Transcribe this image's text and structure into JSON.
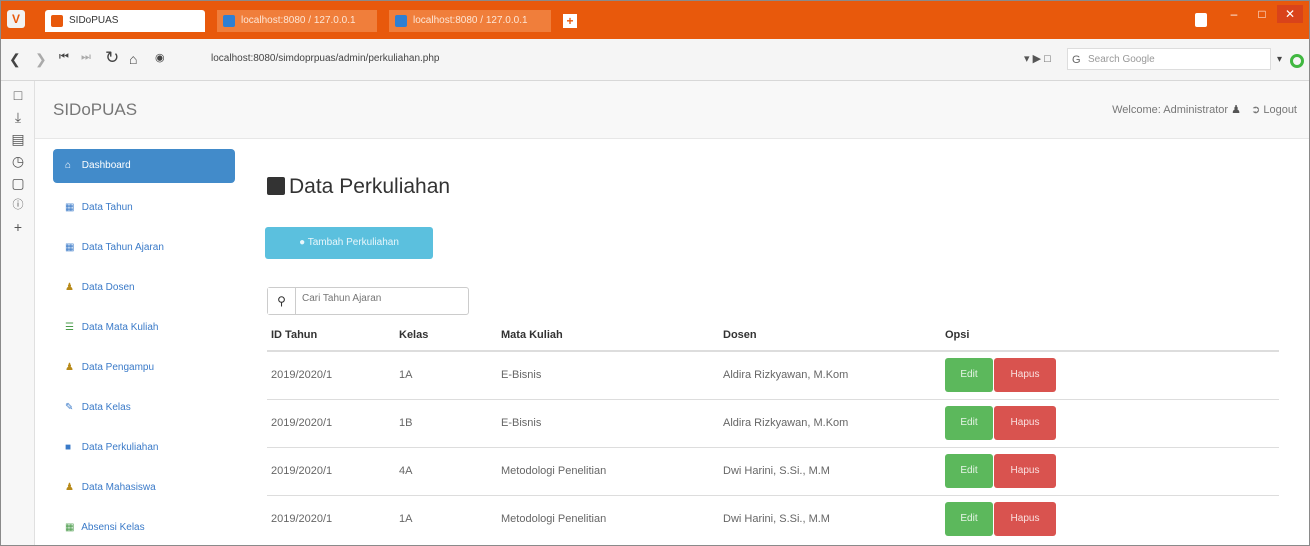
{
  "browser": {
    "tabs": [
      {
        "label": "SIDoPUAS"
      },
      {
        "label": "localhost:8080 / 127.0.0.1"
      },
      {
        "label": "localhost:8080 / 127.0.0.1"
      }
    ],
    "url": "localhost:8080/simdoprpuas/admin/perkuliahan.php",
    "search_placeholder": "Search Google"
  },
  "header": {
    "brand": "SIDoPUAS",
    "welcome": "Welcome: Administrator",
    "logout": "Logout"
  },
  "sidebar": {
    "items": [
      {
        "label": "Dashboard",
        "icon": "home-icon",
        "active": true
      },
      {
        "label": "Data Tahun",
        "icon": "table-icon"
      },
      {
        "label": "Data Tahun Ajaran",
        "icon": "table-icon"
      },
      {
        "label": "Data Dosen",
        "icon": "user-icon"
      },
      {
        "label": "Data Mata Kuliah",
        "icon": "list-icon"
      },
      {
        "label": "Data Pengampu",
        "icon": "user-icon"
      },
      {
        "label": "Data Kelas",
        "icon": "pencil-icon"
      },
      {
        "label": "Data Perkuliahan",
        "icon": "book-icon"
      },
      {
        "label": "Data Mahasiswa",
        "icon": "user-icon"
      },
      {
        "label": "Absensi Kelas",
        "icon": "table-icon"
      }
    ]
  },
  "main": {
    "title": "Data Perkuliahan",
    "add_button": "Tambah Perkuliahan",
    "search_placeholder": "Cari Tahun Ajaran",
    "columns": [
      "ID Tahun",
      "Kelas",
      "Mata Kuliah",
      "Dosen",
      "Opsi"
    ],
    "rows": [
      {
        "id_tahun": "2019/2020/1",
        "kelas": "1A",
        "mata_kuliah": "E-Bisnis",
        "dosen": "Aldira Rizkyawan, M.Kom"
      },
      {
        "id_tahun": "2019/2020/1",
        "kelas": "1B",
        "mata_kuliah": "E-Bisnis",
        "dosen": "Aldira Rizkyawan, M.Kom"
      },
      {
        "id_tahun": "2019/2020/1",
        "kelas": "4A",
        "mata_kuliah": "Metodologi Penelitian",
        "dosen": "Dwi Harini, S.Si., M.M"
      },
      {
        "id_tahun": "2019/2020/1",
        "kelas": "1A",
        "mata_kuliah": "Metodologi Penelitian",
        "dosen": "Dwi Harini, S.Si., M.M"
      }
    ],
    "edit_label": "Edit",
    "delete_label": "Hapus"
  },
  "colors": {
    "browser_accent": "#e8590c",
    "primary": "#428bca",
    "info": "#5bc0de",
    "success": "#5cb85c",
    "danger": "#d9534f"
  }
}
